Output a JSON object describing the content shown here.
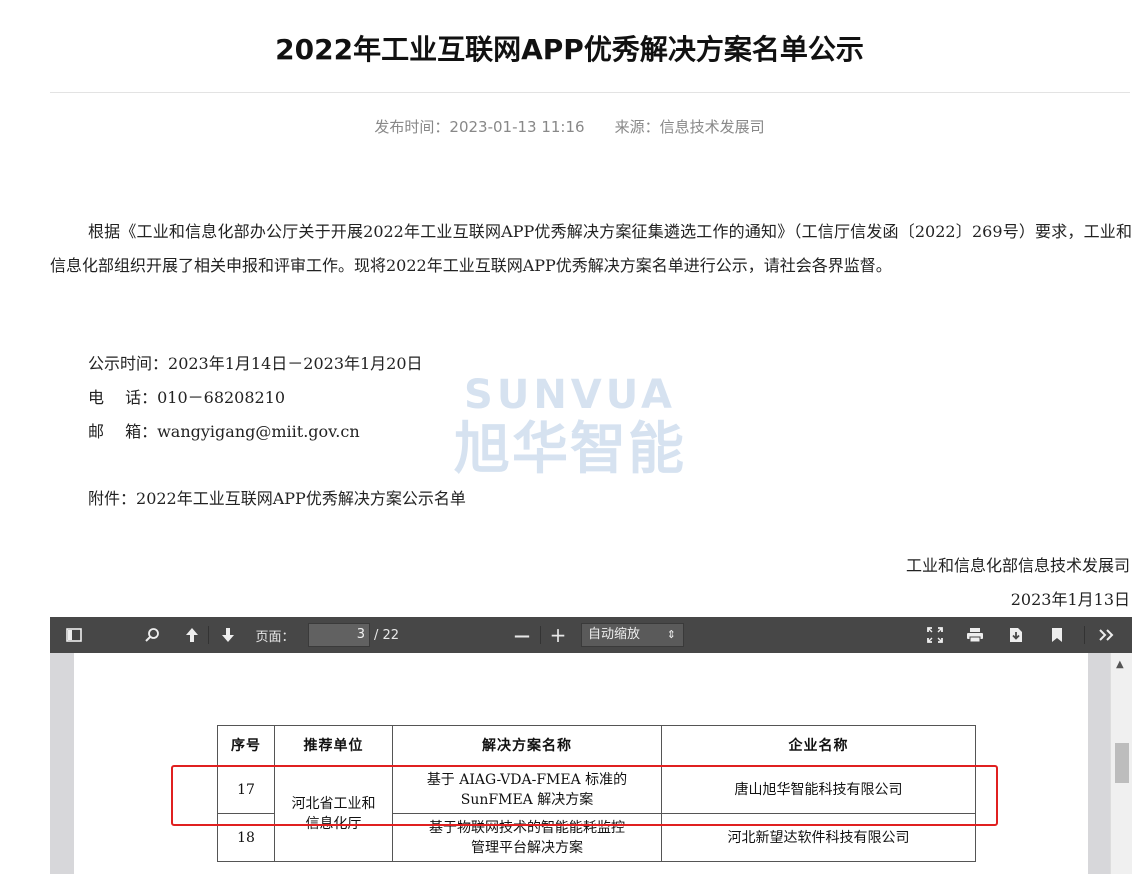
{
  "article": {
    "title": "2022年工业互联网APP优秀解决方案名单公示",
    "publish_time": "发布时间：2023-01-13 11:16",
    "source": "来源：信息技术发展司",
    "body": "根据《工业和信息化部办公厅关于开展2022年工业互联网APP优秀解决方案征集遴选工作的通知》（工信厅信发函〔2022〕269号）要求，工业和信息化部组织开展了相关申报和评审工作。现将2022年工业互联网APP优秀解决方案名单进行公示，请社会各界监督。",
    "notice_period_label": "公示时间：",
    "notice_period": "2023年1月14日－2023年1月20日",
    "phone_label": "电　 话：",
    "phone": "010－68208210",
    "email_label": "邮　 箱：",
    "email": "wangyigang@miit.gov.cn",
    "attachment_label": "附件：",
    "attachment": "2022年工业互联网APP优秀解决方案公示名单",
    "signature_org": "工业和信息化部信息技术发展司",
    "signature_date": "2023年1月13日"
  },
  "watermark": {
    "line1": "SUNVUA",
    "line2": "旭华智能"
  },
  "pdf_viewer": {
    "page_label": "页面：",
    "current_page": "3",
    "total_pages": "/ 22",
    "zoom_minus": "—",
    "zoom_plus": "+",
    "zoom_value": "自动缩放",
    "table": {
      "headers": [
        "序号",
        "推荐单位",
        "解决方案名称",
        "企业名称"
      ],
      "rows": [
        {
          "no": "17",
          "solution_line1": "基于 AIAG-VDA-FMEA 标准的",
          "solution_line2": "SunFMEA 解决方案",
          "company": "唐山旭华智能科技有限公司"
        },
        {
          "no": "18",
          "solution_line1": "基于物联网技术的智能能耗监控",
          "solution_line2": "管理平台解决方案",
          "company": "河北新望达软件科技有限公司"
        }
      ],
      "unit_line1": "河北省工业和",
      "unit_line2": "信息化厅"
    }
  },
  "colors": {
    "toolbar": "#474747",
    "highlight": "#e02020",
    "watermark": "#c9d9ec"
  }
}
